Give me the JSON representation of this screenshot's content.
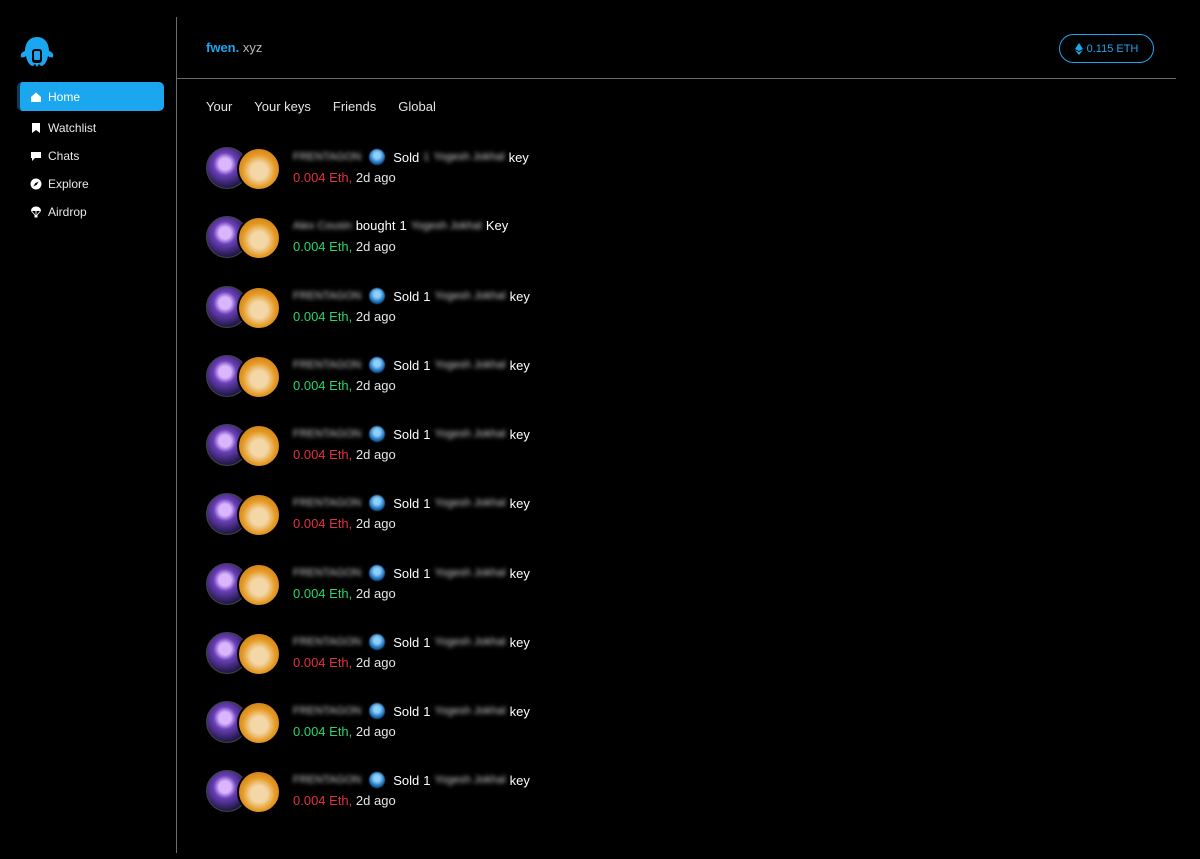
{
  "sidebar": {
    "items": [
      {
        "label": "Home",
        "icon": "home-icon",
        "active": true
      },
      {
        "label": "Watchlist",
        "icon": "bookmark-icon"
      },
      {
        "label": "Chats",
        "icon": "chat-icon"
      },
      {
        "label": "Explore",
        "icon": "compass-icon"
      },
      {
        "label": "Airdrop",
        "icon": "parachute-icon"
      }
    ]
  },
  "header": {
    "brand_main": "fwen.",
    "brand_suffix": "xyz",
    "balance": "0.115 ETH"
  },
  "tabs": [
    "Your",
    "Your keys",
    "Friends",
    "Global"
  ],
  "colors": {
    "accent": "#1aa7ef",
    "sold": "#e0323f",
    "bought": "#2bd46a"
  },
  "feed": [
    {
      "user": "FRENTAGON",
      "action": "Sold",
      "qty": "1",
      "subject": "Yogesh Jokhal",
      "tail": "key",
      "amount": "0.004 Eth,",
      "time": "2d ago",
      "tone": "red"
    },
    {
      "user": "Alex Cousin",
      "action": "bought",
      "qty": "1",
      "subject": "Yogesh Jokhal",
      "tail": "Key",
      "amount": "0.004 Eth,",
      "time": "2d ago",
      "tone": "green"
    },
    {
      "user": "FRENTAGON",
      "action": "Sold",
      "qty": "1",
      "subject": "Yogesh Jokhal",
      "tail": "key",
      "amount": "0.004 Eth,",
      "time": "2d ago",
      "tone": "green"
    },
    {
      "user": "FRENTAGON",
      "action": "Sold",
      "qty": "1",
      "subject": "Yogesh Jokhal",
      "tail": "key",
      "amount": "0.004 Eth,",
      "time": "2d ago",
      "tone": "green"
    },
    {
      "user": "FRENTAGON",
      "action": "Sold",
      "qty": "1",
      "subject": "Yogesh Jokhal",
      "tail": "key",
      "amount": "0.004 Eth,",
      "time": "2d ago",
      "tone": "red"
    },
    {
      "user": "FRENTAGON",
      "action": "Sold",
      "qty": "1",
      "subject": "Yogesh Jokhal",
      "tail": "key",
      "amount": "0.004 Eth,",
      "time": "2d ago",
      "tone": "red"
    },
    {
      "user": "FRENTAGON",
      "action": "Sold",
      "qty": "1",
      "subject": "Yogesh Jokhal",
      "tail": "key",
      "amount": "0.004 Eth,",
      "time": "2d ago",
      "tone": "green"
    },
    {
      "user": "FRENTAGON",
      "action": "Sold",
      "qty": "1",
      "subject": "Yogesh Jokhal",
      "tail": "key",
      "amount": "0.004 Eth,",
      "time": "2d ago",
      "tone": "red"
    },
    {
      "user": "FRENTAGON",
      "action": "Sold",
      "qty": "1",
      "subject": "Yogesh Jokhal",
      "tail": "key",
      "amount": "0.004 Eth,",
      "time": "2d ago",
      "tone": "green"
    },
    {
      "user": "FRENTAGON",
      "action": "Sold",
      "qty": "1",
      "subject": "Yogesh Jokhal",
      "tail": "key",
      "amount": "0.004 Eth,",
      "time": "2d ago",
      "tone": "red"
    }
  ]
}
